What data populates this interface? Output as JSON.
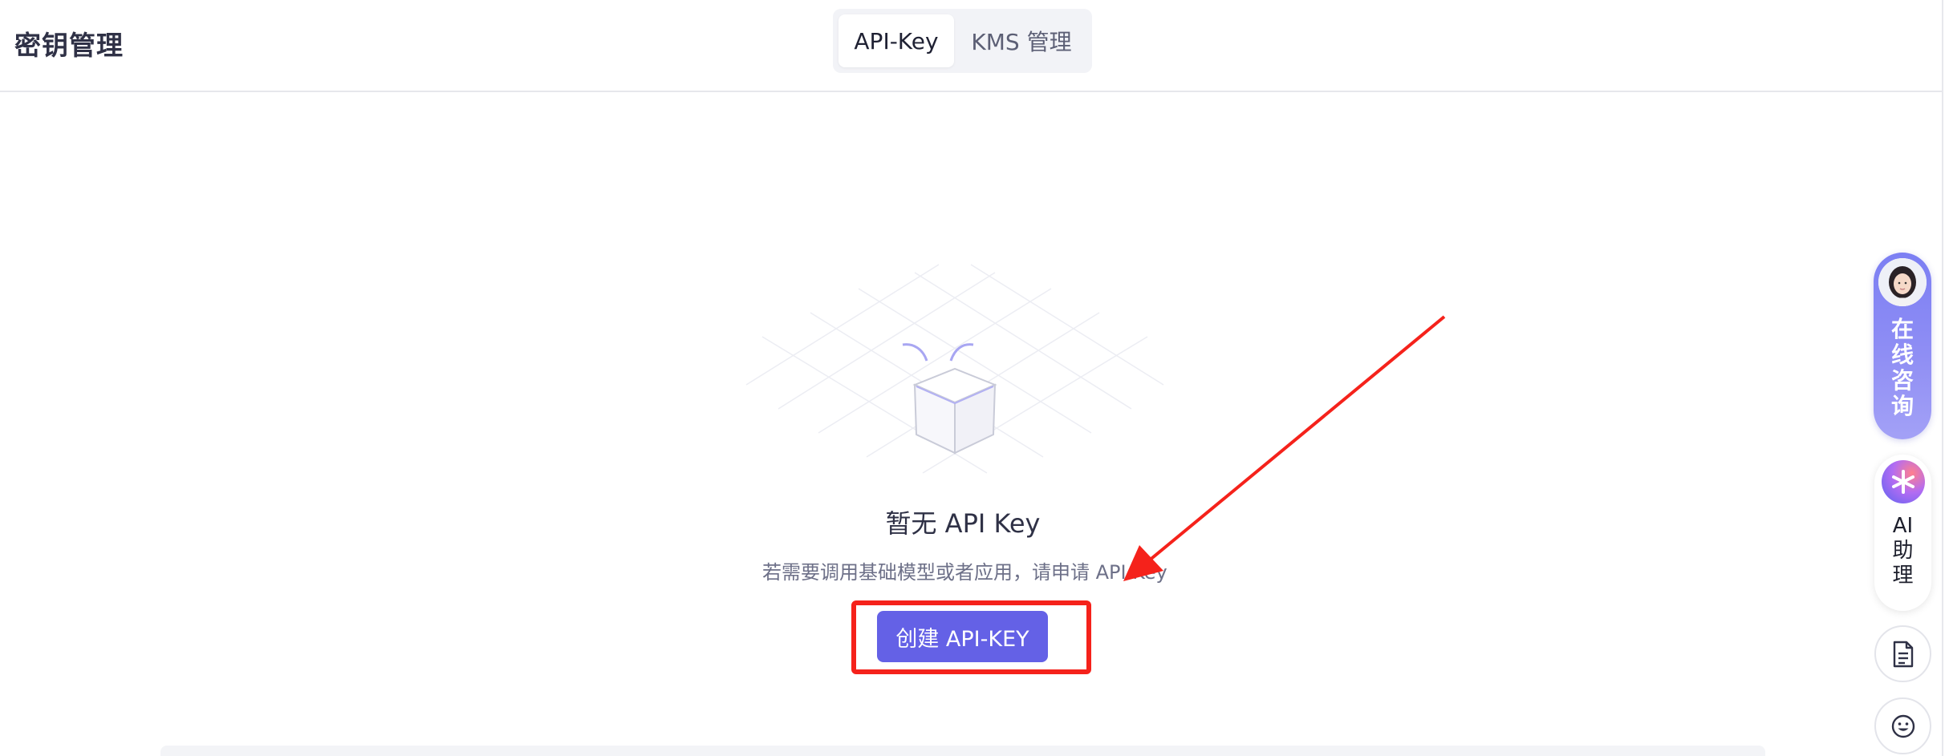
{
  "header": {
    "title": "密钥管理",
    "tabs": [
      {
        "label": "API-Key",
        "active": true
      },
      {
        "label": "KMS 管理",
        "active": false
      }
    ]
  },
  "empty_state": {
    "title": "暂无 API Key",
    "description": "若需要调用基础模型或者应用，请申请 API Key",
    "create_button": "创建 API-KEY"
  },
  "floating": {
    "consult_label": [
      "在",
      "线",
      "咨",
      "询"
    ],
    "ai_label": [
      "AI",
      "助",
      "理"
    ],
    "icons": [
      "avatar",
      "ai-assistant-icon",
      "document-icon",
      "smile-icon"
    ]
  },
  "annotation": {
    "highlight_color": "#f5221b",
    "arrow_color": "#f5221b"
  },
  "colors": {
    "accent": "#6461e6",
    "consult_gradient_top": "#7c7ff3"
  }
}
